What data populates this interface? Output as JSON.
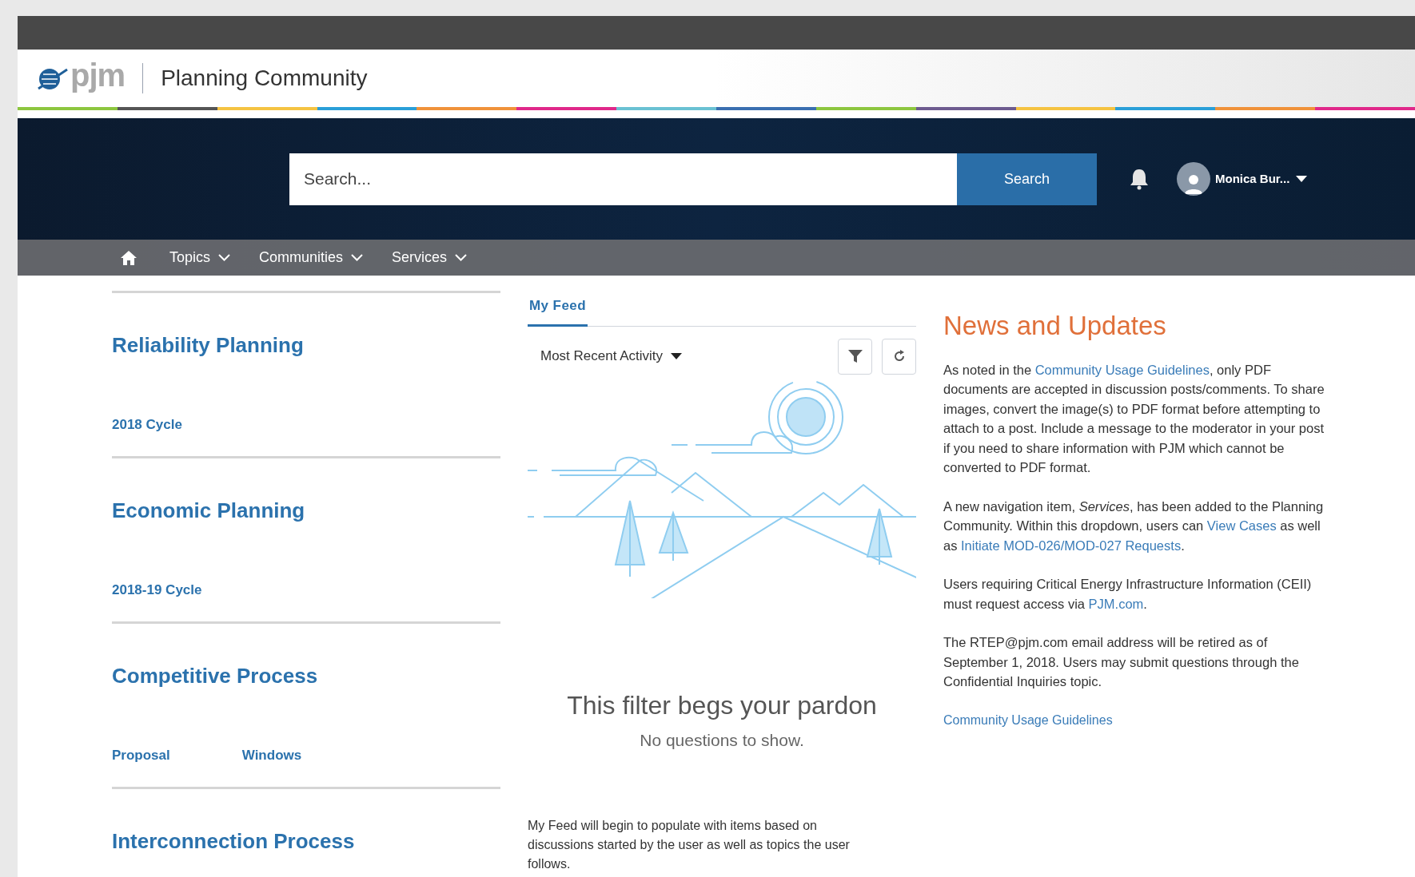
{
  "header": {
    "logo_text": "pjm",
    "site_title": "Planning Community"
  },
  "search": {
    "placeholder": "Search...",
    "button": "Search"
  },
  "user": {
    "name": "Monica Bur..."
  },
  "nav": [
    {
      "kind": "home"
    },
    {
      "kind": "menu",
      "label": "Topics"
    },
    {
      "kind": "menu",
      "label": "Communities"
    },
    {
      "kind": "menu",
      "label": "Services"
    }
  ],
  "sections": [
    {
      "title": "Reliability Planning",
      "links": [
        "2018 Cycle"
      ]
    },
    {
      "title": "Economic Planning",
      "links": [
        "2018-19 Cycle"
      ]
    },
    {
      "title": "Competitive Process",
      "links": [
        "Proposal",
        "Windows"
      ]
    },
    {
      "title": "Interconnection Process"
    }
  ],
  "feed": {
    "tabs": [
      {
        "label": "My Feed",
        "selected": true
      }
    ],
    "sort": "Most Recent Activity",
    "empty_title": "This filter begs your pardon",
    "empty_text": "No questions to show.",
    "note": "My Feed will begin to populate with items based on discussions started by the user as well as topics the user follows."
  },
  "news": {
    "title": "News and Updates",
    "paragraphs": [
      [
        {
          "kind": "text",
          "text": "As noted in the "
        },
        {
          "kind": "link",
          "text": "Community Usage Guidelines"
        },
        {
          "kind": "text",
          "text": ", only PDF documents are accepted in discussion posts/comments.  To share images, convert the image(s) to PDF format before attempting to attach to a post.  Include a message to the moderator in your post if you need to share information with PJM which cannot be converted to PDF format."
        }
      ],
      [
        {
          "kind": "text",
          "text": "A new navigation item, *Services*, has been added to the Planning Community.  Within this dropdown, users can "
        },
        {
          "kind": "link",
          "text": "View Cases"
        },
        {
          "kind": "text",
          "text": " as well as "
        },
        {
          "kind": "link",
          "text": "Initiate MOD-026/MOD-027 Requests"
        },
        {
          "kind": "text",
          "text": "."
        }
      ],
      [
        {
          "kind": "text",
          "text": "Users requiring Critical Energy Infrastructure Information (CEII) must request access via "
        },
        {
          "kind": "link",
          "text": "PJM.com"
        },
        {
          "kind": "text",
          "text": "."
        }
      ],
      [
        {
          "kind": "text",
          "text": "The RTEP@pjm.com email address will be retired as of September 1, 2018.  Users may submit questions through the Confidential Inquiries topic."
        }
      ]
    ],
    "footer_link": "Community Usage Guidelines"
  }
}
